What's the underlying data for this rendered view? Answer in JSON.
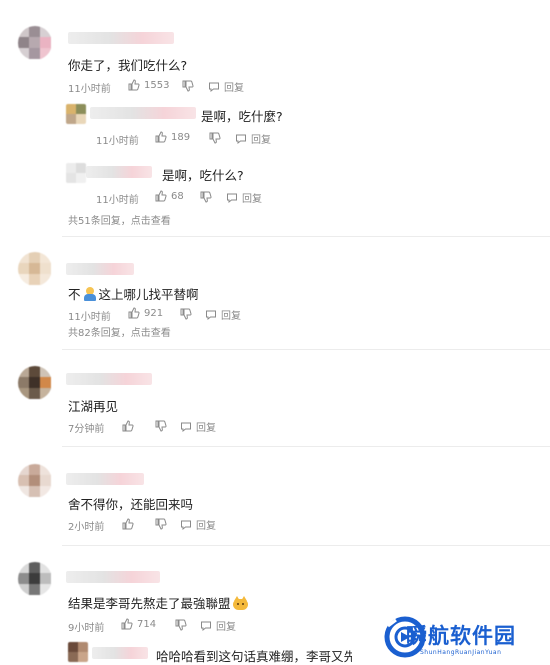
{
  "comments": [
    {
      "text": "你走了，我们吃什么?",
      "time": "11小时前",
      "likes": "1553",
      "reply": "回复",
      "replies": [
        {
          "text": "是啊，吃什麼?",
          "time": "11小时前",
          "likes": "189",
          "reply": "回复"
        },
        {
          "text": "是啊，吃什么?",
          "time": "11小时前",
          "likes": "68",
          "reply": "回复"
        }
      ],
      "more": "共51条回复，点击查看"
    },
    {
      "text_before": "不",
      "emoji": "person-emoji",
      "text_after": "这上哪儿找平替啊",
      "time": "11小时前",
      "likes": "921",
      "reply": "回复",
      "more": "共82条回复，点击查看"
    },
    {
      "text": "江湖再见",
      "time": "7分钟前",
      "reply": "回复"
    },
    {
      "text": "舍不得你，还能回来吗",
      "time": "2小时前",
      "reply": "回复"
    },
    {
      "text": "结果是李哥先熬走了最強聯盟",
      "emoji": "cat-emoji",
      "time": "9小时前",
      "likes": "714",
      "reply": "回复",
      "replies": [
        {
          "text": "哈哈哈看到这句话真难绷，李哥又先"
        }
      ]
    }
  ],
  "watermark": {
    "title": "瞬航软件园",
    "subtitle": "ShunHangRuanJianYuan"
  },
  "colors": {
    "accent": "#1a5fd0",
    "meta": "#8a8a8a",
    "text": "#222222"
  }
}
